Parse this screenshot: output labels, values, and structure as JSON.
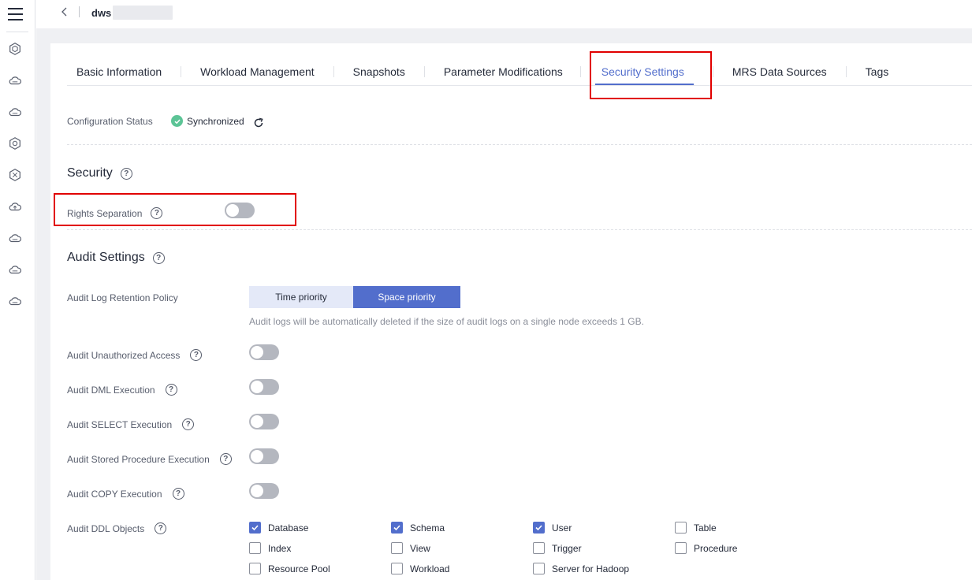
{
  "topbar": {
    "title": "dws"
  },
  "tabs": [
    {
      "label": "Basic Information"
    },
    {
      "label": "Workload Management"
    },
    {
      "label": "Snapshots"
    },
    {
      "label": "Parameter Modifications"
    },
    {
      "label": "Security Settings",
      "active": true
    },
    {
      "label": "MRS Data Sources"
    },
    {
      "label": "Tags"
    }
  ],
  "config_status": {
    "label": "Configuration Status",
    "value": "Synchronized",
    "color": "#5cc496"
  },
  "security": {
    "title": "Security",
    "rights_separation": {
      "label": "Rights Separation",
      "enabled": false
    }
  },
  "audit": {
    "title": "Audit Settings",
    "retention": {
      "label": "Audit Log Retention Policy",
      "options": [
        "Time priority",
        "Space priority"
      ],
      "selected": "Space priority",
      "hint": "Audit logs will be automatically deleted if the size of audit logs on a single node exceeds 1 GB."
    },
    "toggles": [
      {
        "label": "Audit Unauthorized Access",
        "enabled": false
      },
      {
        "label": "Audit DML Execution",
        "enabled": false
      },
      {
        "label": "Audit SELECT Execution",
        "enabled": false
      },
      {
        "label": "Audit Stored Procedure Execution",
        "enabled": false
      },
      {
        "label": "Audit COPY Execution",
        "enabled": false
      }
    ],
    "ddl": {
      "label": "Audit DDL Objects",
      "objects": [
        {
          "label": "Database",
          "checked": true
        },
        {
          "label": "Schema",
          "checked": true
        },
        {
          "label": "User",
          "checked": true
        },
        {
          "label": "Table",
          "checked": false
        },
        {
          "label": "Index",
          "checked": false
        },
        {
          "label": "View",
          "checked": false
        },
        {
          "label": "Trigger",
          "checked": false
        },
        {
          "label": "Procedure",
          "checked": false
        },
        {
          "label": "Resource Pool",
          "checked": false
        },
        {
          "label": "Workload",
          "checked": false
        },
        {
          "label": "Server for Hadoop",
          "checked": false
        }
      ]
    }
  },
  "colors": {
    "accent": "#526ecc",
    "highlight": "#e10000"
  }
}
